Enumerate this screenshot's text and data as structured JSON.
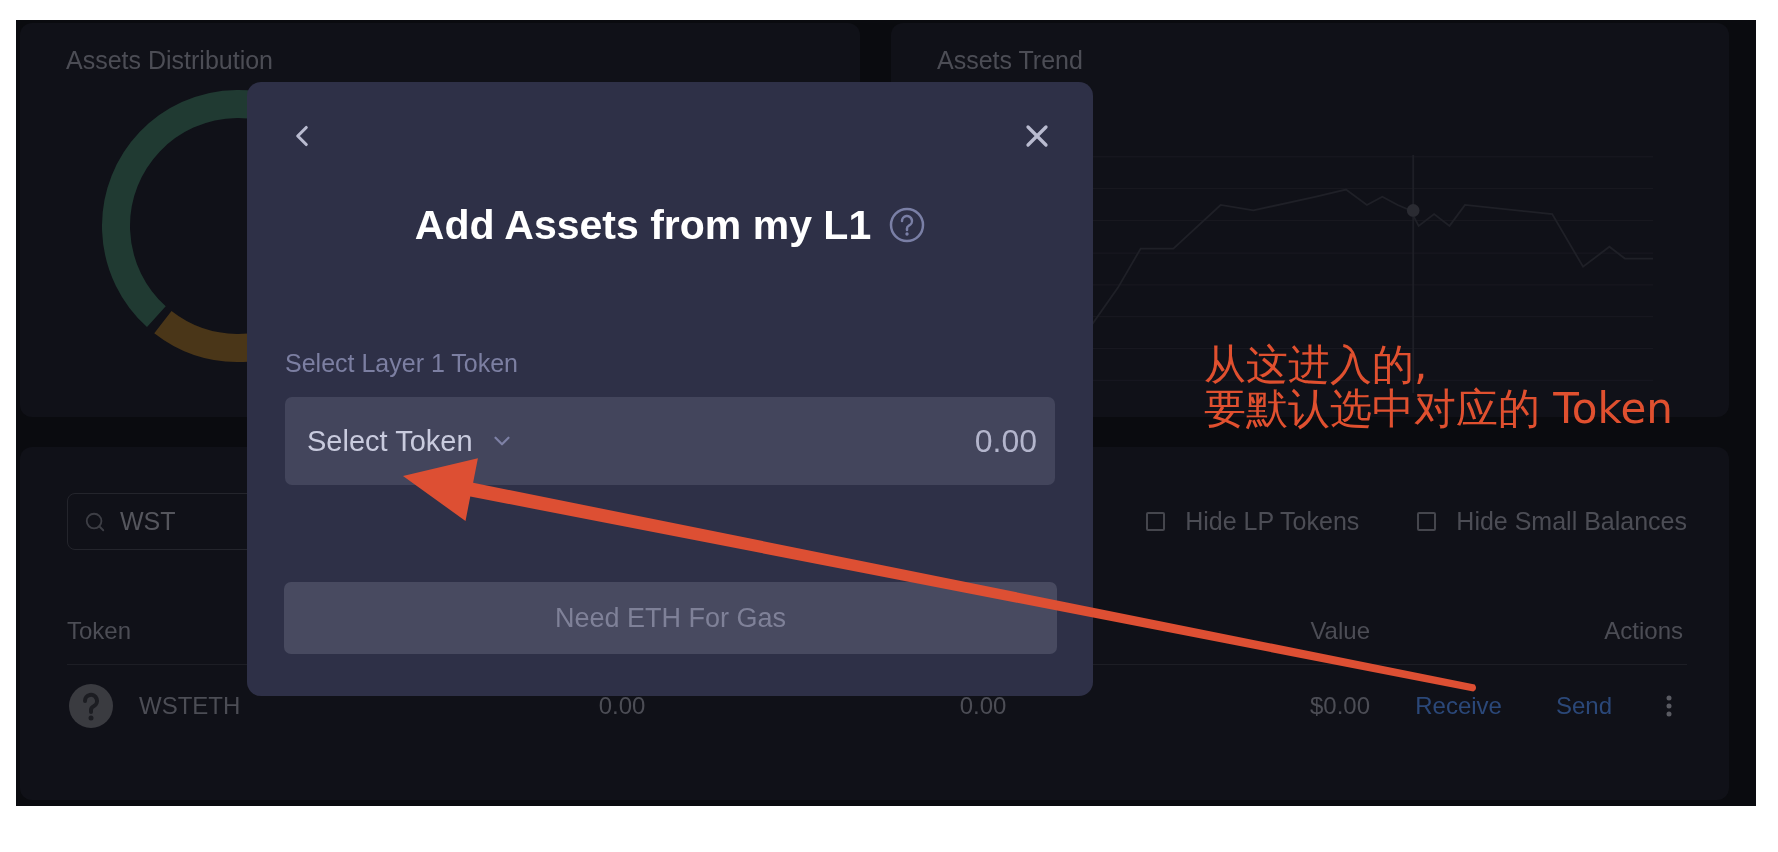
{
  "assets_distribution": {
    "title": "Assets Distribution"
  },
  "assets_trend": {
    "title": "Assets Trend"
  },
  "assets_table": {
    "search": {
      "value": "WST"
    },
    "filters": [
      {
        "label": "Hide LP Tokens",
        "checked": false
      },
      {
        "label": "Hide Small Balances",
        "checked": false
      }
    ],
    "columns": [
      "Token",
      "Value",
      "Actions"
    ],
    "rows": [
      {
        "token": "WSTETH",
        "column_2": "0.00",
        "column_3": "0.00",
        "value": "$0.00",
        "actions": [
          "Receive",
          "Send"
        ]
      }
    ]
  },
  "modal": {
    "title": "Add Assets from my L1",
    "field_label": "Select Layer 1 Token",
    "token_select": "Select Token",
    "amount": "0.00",
    "button": {
      "label": "Need ETH For Gas",
      "disabled": true
    }
  },
  "annotation": {
    "lines": [
      "从这进入的,",
      "要默认选中对应的 Token"
    ]
  }
}
